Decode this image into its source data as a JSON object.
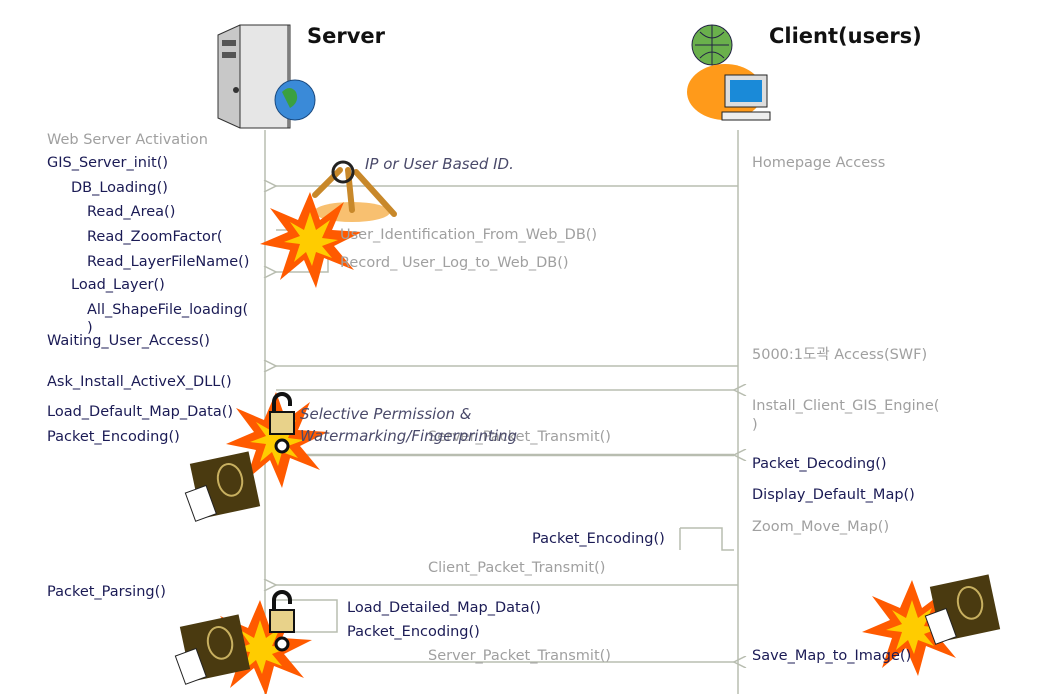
{
  "actors": {
    "server": "Server",
    "client": "Client(users)"
  },
  "server_steps": [
    {
      "text": "Web Server Activation",
      "style": "gray"
    },
    {
      "text": "GIS_Server_init()",
      "style": "dark"
    },
    {
      "text": "DB_Loading()",
      "style": "dark"
    },
    {
      "text": "Read_Area()",
      "style": "dark"
    },
    {
      "text": "Read_ZoomFactor(",
      "style": "dark"
    },
    {
      "text": "Read_LayerFileName()",
      "style": "dark"
    },
    {
      "text": "Load_Layer()",
      "style": "dark"
    },
    {
      "text": "All_ShapeFile_loading(",
      "style": "dark"
    },
    {
      "text": ")",
      "style": "dark"
    },
    {
      "text": "Waiting_User_Access()",
      "style": "dark"
    },
    {
      "text": "Ask_Install_ActiveX_DLL()",
      "style": "dark"
    },
    {
      "text": "Load_Default_Map_Data()",
      "style": "dark"
    },
    {
      "text": "Packet_Encoding()",
      "style": "dark"
    },
    {
      "text": "Packet_Parsing()",
      "style": "dark"
    }
  ],
  "client_steps": [
    {
      "text": "Homepage Access",
      "style": "gray"
    },
    {
      "text": "5000:1도곽 Access(SWF)",
      "style": "gray"
    },
    {
      "text": "Install_Client_GIS_Engine(",
      "style": "gray"
    },
    {
      "text": ")",
      "style": "gray"
    },
    {
      "text": "Packet_Decoding()",
      "style": "dark"
    },
    {
      "text": "Display_Default_Map()",
      "style": "dark"
    },
    {
      "text": "Zoom_Move_Map()",
      "style": "gray"
    },
    {
      "text": "Save_Map_to_Image()",
      "style": "dark"
    }
  ],
  "messages": {
    "user_identification": "User_Identification_From_Web_DB()",
    "record_log": "Record_ User_Log_to_Web_DB()",
    "server_transmit_1": "Server_Packet_Transmit()",
    "client_packet_encoding": "Packet_Encoding()",
    "client_transmit": "Client_Packet_Transmit()",
    "load_detailed": "Load_Detailed_Map_Data()",
    "server_packet_encoding": "Packet_Encoding()",
    "server_transmit_2": "Server_Packet_Transmit()"
  },
  "annotations": {
    "auth": "IP or User Based ID.",
    "permission_line1": "Selective  Permission &",
    "permission_line2": "Watermarking/Fingerprinting"
  },
  "colors": {
    "dark_text": "#1b1b55",
    "gray_text": "#a0a0a0",
    "line": "#b8bdb0",
    "burst_outer": "#ff5a00",
    "burst_inner": "#ffd000"
  }
}
